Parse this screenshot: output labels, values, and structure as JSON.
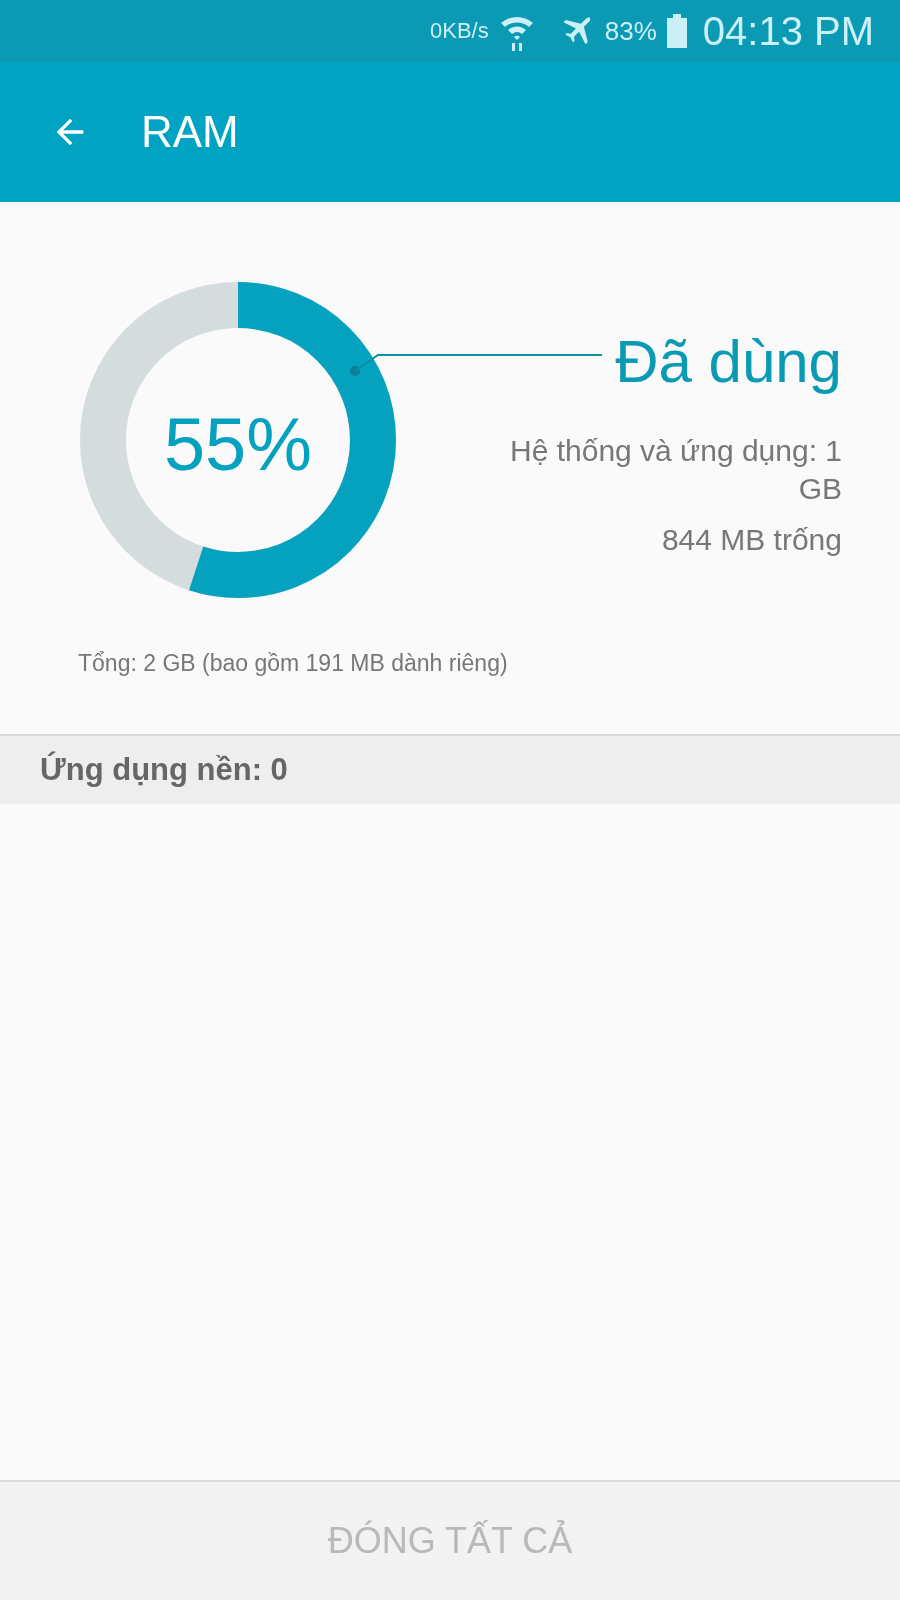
{
  "status_bar": {
    "speed": "0KB/s",
    "battery": "83%",
    "time": "04:13 PM"
  },
  "app_bar": {
    "title": "RAM"
  },
  "memory": {
    "level": 0.55,
    "percent": "55%",
    "used_label": "Đã dùng",
    "system_apps": "Hệ thống và ứng dụng: 1 GB",
    "free": "844 MB trống",
    "total": "Tổng: 2 GB (bao gồm 191 MB dành riêng)"
  },
  "background_apps": {
    "label": "Ứng dụng nền: 0"
  },
  "close_all": {
    "label": "ĐÓNG TẤT CẢ",
    "disabled": true
  }
}
